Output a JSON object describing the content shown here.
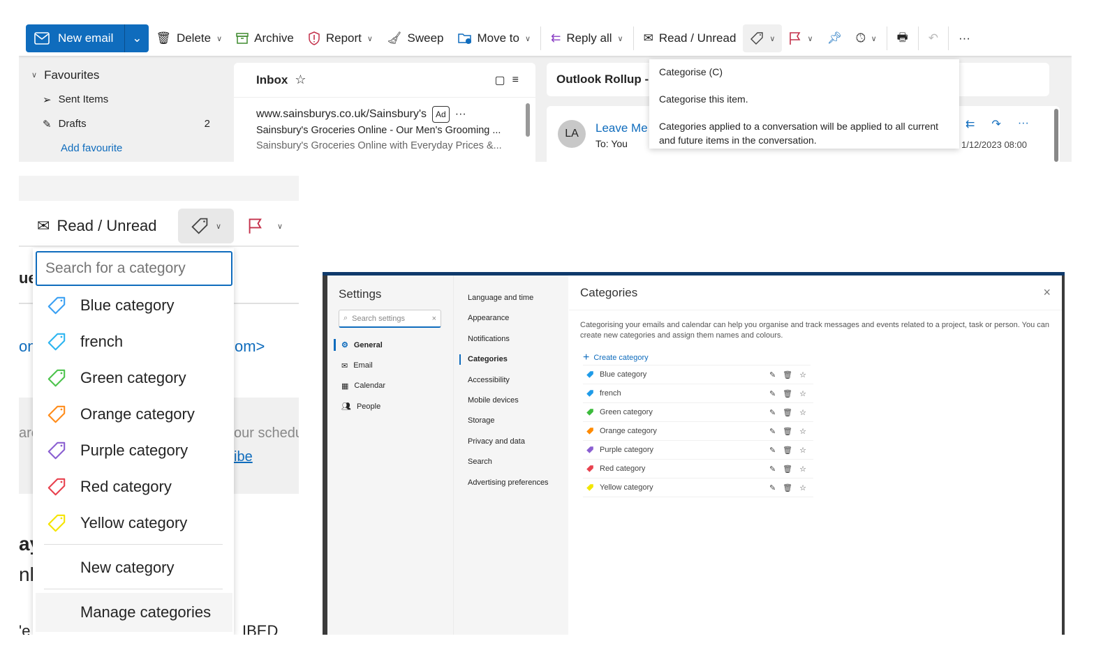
{
  "toolbar": {
    "new_email": "New email",
    "delete": "Delete",
    "archive": "Archive",
    "report": "Report",
    "sweep": "Sweep",
    "move_to": "Move to",
    "reply_all": "Reply all",
    "read_unread": "Read / Unread",
    "more": "···"
  },
  "nav": {
    "favourites": "Favourites",
    "items": [
      {
        "label": "Sent Items",
        "count": ""
      },
      {
        "label": "Drafts",
        "count": "2"
      }
    ],
    "add_favourite": "Add favourite"
  },
  "inbox": {
    "title": "Inbox",
    "message": {
      "sender": "www.sainsburys.co.uk/Sainsbury's",
      "badge": "Ad",
      "subject": "Sainsbury's Groceries Online - Our Men's Grooming ...",
      "preview": "Sainsbury's Groceries Online with Everyday Prices &..."
    }
  },
  "reading": {
    "title": "Outlook Rollup -",
    "avatar": "LA",
    "sender": "Leave Me",
    "to": "To:  You",
    "date": "1/12/2023 08:00"
  },
  "tooltip": {
    "title": "Categorise (C)",
    "line1": "Categorise this item.",
    "line2": "Categories applied to a conversation will be applied to all current and future items in the conversation."
  },
  "menu": {
    "read_unread": "Read / Unread",
    "search_placeholder": "Search for a category",
    "categories": [
      {
        "name": "Blue category",
        "color": "#3aa0f3"
      },
      {
        "name": "french",
        "color": "#2db5f0"
      },
      {
        "name": "Green category",
        "color": "#4cc34c"
      },
      {
        "name": "Orange category",
        "color": "#ff8c1a"
      },
      {
        "name": "Purple category",
        "color": "#8a5fd1"
      },
      {
        "name": "Red category",
        "color": "#e8414e"
      },
      {
        "name": "Yellow category",
        "color": "#f5e400"
      }
    ],
    "new_category": "New category",
    "manage_categories": "Manage categories",
    "bg_fragments": [
      "ue",
      "on",
      "om>",
      "are",
      "our schedu",
      "ibe",
      "ay",
      "nl",
      "'e",
      "IBED Lo"
    ]
  },
  "settings": {
    "title": "Settings",
    "search_placeholder": "Search settings",
    "nav": [
      "General",
      "Email",
      "Calendar",
      "People"
    ],
    "sub": [
      "Language and time",
      "Appearance",
      "Notifications",
      "Categories",
      "Accessibility",
      "Mobile devices",
      "Storage",
      "Privacy and data",
      "Search",
      "Advertising preferences"
    ],
    "panel_title": "Categories",
    "description": "Categorising your emails and calendar can help you organise and track messages and events related to a project, task or person. You can create new categories and assign them names and colours.",
    "create": "Create category",
    "categories": [
      {
        "name": "Blue category",
        "color": "#1e9be8"
      },
      {
        "name": "french",
        "color": "#1e9be8"
      },
      {
        "name": "Green category",
        "color": "#3cbb3c"
      },
      {
        "name": "Orange category",
        "color": "#ff8a00"
      },
      {
        "name": "Purple category",
        "color": "#8a5fd1"
      },
      {
        "name": "Red category",
        "color": "#e8414e"
      },
      {
        "name": "Yellow category",
        "color": "#f2e600"
      }
    ]
  },
  "colors": {
    "accent": "#0f6cbd"
  }
}
